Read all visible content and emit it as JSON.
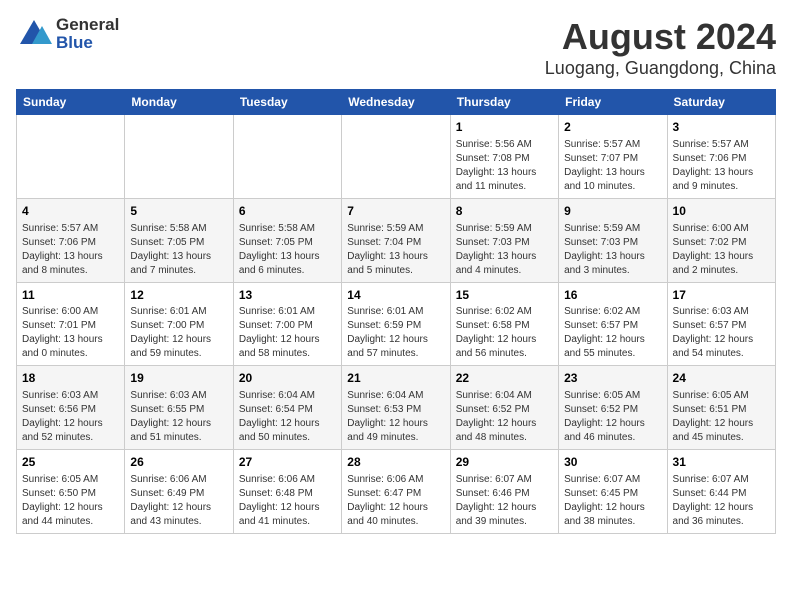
{
  "header": {
    "logo_general": "General",
    "logo_blue": "Blue",
    "title": "August 2024",
    "subtitle": "Luogang, Guangdong, China"
  },
  "days_of_week": [
    "Sunday",
    "Monday",
    "Tuesday",
    "Wednesday",
    "Thursday",
    "Friday",
    "Saturday"
  ],
  "weeks": [
    [
      {
        "day": "",
        "info": ""
      },
      {
        "day": "",
        "info": ""
      },
      {
        "day": "",
        "info": ""
      },
      {
        "day": "",
        "info": ""
      },
      {
        "day": "1",
        "info": "Sunrise: 5:56 AM\nSunset: 7:08 PM\nDaylight: 13 hours and 11 minutes."
      },
      {
        "day": "2",
        "info": "Sunrise: 5:57 AM\nSunset: 7:07 PM\nDaylight: 13 hours and 10 minutes."
      },
      {
        "day": "3",
        "info": "Sunrise: 5:57 AM\nSunset: 7:06 PM\nDaylight: 13 hours and 9 minutes."
      }
    ],
    [
      {
        "day": "4",
        "info": "Sunrise: 5:57 AM\nSunset: 7:06 PM\nDaylight: 13 hours and 8 minutes."
      },
      {
        "day": "5",
        "info": "Sunrise: 5:58 AM\nSunset: 7:05 PM\nDaylight: 13 hours and 7 minutes."
      },
      {
        "day": "6",
        "info": "Sunrise: 5:58 AM\nSunset: 7:05 PM\nDaylight: 13 hours and 6 minutes."
      },
      {
        "day": "7",
        "info": "Sunrise: 5:59 AM\nSunset: 7:04 PM\nDaylight: 13 hours and 5 minutes."
      },
      {
        "day": "8",
        "info": "Sunrise: 5:59 AM\nSunset: 7:03 PM\nDaylight: 13 hours and 4 minutes."
      },
      {
        "day": "9",
        "info": "Sunrise: 5:59 AM\nSunset: 7:03 PM\nDaylight: 13 hours and 3 minutes."
      },
      {
        "day": "10",
        "info": "Sunrise: 6:00 AM\nSunset: 7:02 PM\nDaylight: 13 hours and 2 minutes."
      }
    ],
    [
      {
        "day": "11",
        "info": "Sunrise: 6:00 AM\nSunset: 7:01 PM\nDaylight: 13 hours and 0 minutes."
      },
      {
        "day": "12",
        "info": "Sunrise: 6:01 AM\nSunset: 7:00 PM\nDaylight: 12 hours and 59 minutes."
      },
      {
        "day": "13",
        "info": "Sunrise: 6:01 AM\nSunset: 7:00 PM\nDaylight: 12 hours and 58 minutes."
      },
      {
        "day": "14",
        "info": "Sunrise: 6:01 AM\nSunset: 6:59 PM\nDaylight: 12 hours and 57 minutes."
      },
      {
        "day": "15",
        "info": "Sunrise: 6:02 AM\nSunset: 6:58 PM\nDaylight: 12 hours and 56 minutes."
      },
      {
        "day": "16",
        "info": "Sunrise: 6:02 AM\nSunset: 6:57 PM\nDaylight: 12 hours and 55 minutes."
      },
      {
        "day": "17",
        "info": "Sunrise: 6:03 AM\nSunset: 6:57 PM\nDaylight: 12 hours and 54 minutes."
      }
    ],
    [
      {
        "day": "18",
        "info": "Sunrise: 6:03 AM\nSunset: 6:56 PM\nDaylight: 12 hours and 52 minutes."
      },
      {
        "day": "19",
        "info": "Sunrise: 6:03 AM\nSunset: 6:55 PM\nDaylight: 12 hours and 51 minutes."
      },
      {
        "day": "20",
        "info": "Sunrise: 6:04 AM\nSunset: 6:54 PM\nDaylight: 12 hours and 50 minutes."
      },
      {
        "day": "21",
        "info": "Sunrise: 6:04 AM\nSunset: 6:53 PM\nDaylight: 12 hours and 49 minutes."
      },
      {
        "day": "22",
        "info": "Sunrise: 6:04 AM\nSunset: 6:52 PM\nDaylight: 12 hours and 48 minutes."
      },
      {
        "day": "23",
        "info": "Sunrise: 6:05 AM\nSunset: 6:52 PM\nDaylight: 12 hours and 46 minutes."
      },
      {
        "day": "24",
        "info": "Sunrise: 6:05 AM\nSunset: 6:51 PM\nDaylight: 12 hours and 45 minutes."
      }
    ],
    [
      {
        "day": "25",
        "info": "Sunrise: 6:05 AM\nSunset: 6:50 PM\nDaylight: 12 hours and 44 minutes."
      },
      {
        "day": "26",
        "info": "Sunrise: 6:06 AM\nSunset: 6:49 PM\nDaylight: 12 hours and 43 minutes."
      },
      {
        "day": "27",
        "info": "Sunrise: 6:06 AM\nSunset: 6:48 PM\nDaylight: 12 hours and 41 minutes."
      },
      {
        "day": "28",
        "info": "Sunrise: 6:06 AM\nSunset: 6:47 PM\nDaylight: 12 hours and 40 minutes."
      },
      {
        "day": "29",
        "info": "Sunrise: 6:07 AM\nSunset: 6:46 PM\nDaylight: 12 hours and 39 minutes."
      },
      {
        "day": "30",
        "info": "Sunrise: 6:07 AM\nSunset: 6:45 PM\nDaylight: 12 hours and 38 minutes."
      },
      {
        "day": "31",
        "info": "Sunrise: 6:07 AM\nSunset: 6:44 PM\nDaylight: 12 hours and 36 minutes."
      }
    ]
  ]
}
